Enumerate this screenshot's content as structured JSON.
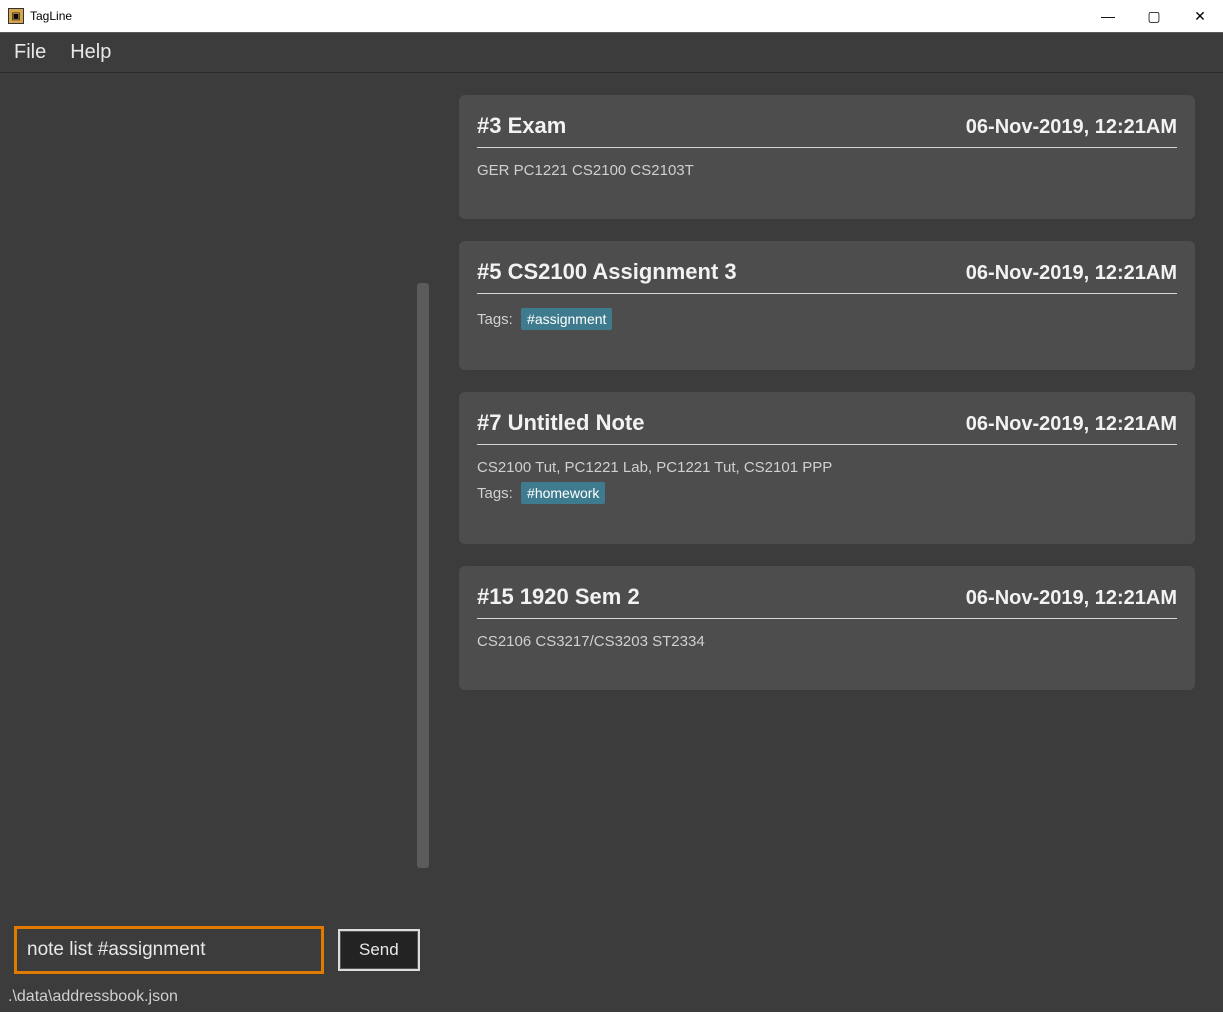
{
  "titlebar": {
    "app_name": "TagLine",
    "win_minimize": "—",
    "win_maximize": "▢",
    "win_close": "✕"
  },
  "menubar": {
    "file": "File",
    "help": "Help"
  },
  "notes": [
    {
      "title": "#3 Exam",
      "date": "06-Nov-2019, 12:21AM",
      "body": "GER PC1221 CS2100 CS2103T",
      "tags": []
    },
    {
      "title": "#5 CS2100 Assignment 3",
      "date": "06-Nov-2019, 12:21AM",
      "body": "",
      "tags": [
        "#assignment"
      ]
    },
    {
      "title": "#7 Untitled Note",
      "date": "06-Nov-2019, 12:21AM",
      "body": "CS2100 Tut, PC1221 Lab, PC1221 Tut, CS2101 PPP",
      "tags": [
        "#homework"
      ]
    },
    {
      "title": "#15 1920 Sem 2",
      "date": "06-Nov-2019, 12:21AM",
      "body": "CS2106 CS3217/CS3203 ST2334",
      "tags": []
    }
  ],
  "tags_label": "Tags:",
  "command": {
    "value": "note list #assignment",
    "send_label": "Send"
  },
  "status": {
    "path": ".\\data\\addressbook.json"
  }
}
